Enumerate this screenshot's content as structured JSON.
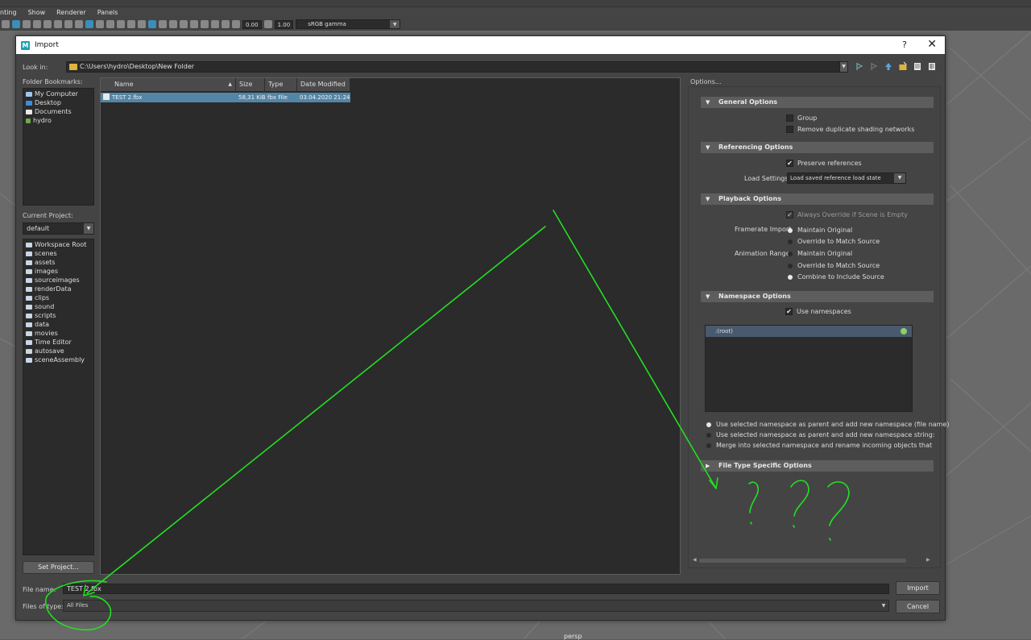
{
  "app": {
    "menu": [
      "nting",
      "Show",
      "Renderer",
      "Panels"
    ],
    "toolbar": {
      "exposure": "0.00",
      "gamma": "1.00",
      "color_space": "sRGB gamma"
    },
    "viewport_label": "persp"
  },
  "dialog": {
    "title": "Import",
    "help_glyph": "?",
    "close_glyph": "✕",
    "look_in_label": "Look in:",
    "look_in_path": "C:\\Users\\hydro\\Desktop\\New Folder",
    "folder_bookmarks_label": "Folder Bookmarks:",
    "bookmarks": [
      {
        "label": "My Computer",
        "icon": "computer-icon"
      },
      {
        "label": "Desktop",
        "icon": "desktop-icon"
      },
      {
        "label": "Documents",
        "icon": "documents-icon"
      },
      {
        "label": "hydro",
        "icon": "user-icon"
      }
    ],
    "current_project_label": "Current Project:",
    "current_project": "default",
    "project_folders": [
      "Workspace Root",
      "scenes",
      "assets",
      "images",
      "sourceimages",
      "renderData",
      "clips",
      "sound",
      "scripts",
      "data",
      "movies",
      "Time Editor",
      "autosave",
      "sceneAssembly"
    ],
    "set_project_button": "Set Project...",
    "table": {
      "columns": [
        "Name",
        "Size",
        "Type",
        "Date Modified"
      ],
      "rows": [
        {
          "name": "TEST 2.fbx",
          "size": "58,31 KiB",
          "type": "fbx File",
          "date": "03.04.2020 21:24"
        }
      ]
    },
    "file_name_label": "File name:",
    "file_name": "TEST 2.fbx",
    "files_of_type_label": "Files of type:",
    "files_of_type": "All Files",
    "import_button": "Import",
    "cancel_button": "Cancel"
  },
  "options": {
    "header": "Options...",
    "general": {
      "title": "General Options",
      "group": "Group",
      "remove_duplicate": "Remove duplicate shading networks"
    },
    "referencing": {
      "title": "Referencing Options",
      "preserve_references": "Preserve references",
      "load_settings_label": "Load Settings",
      "load_settings_value": "Load saved reference load state"
    },
    "playback": {
      "title": "Playback Options",
      "always_override": "Always Override if Scene is Empty",
      "framerate_label": "Framerate Import",
      "framerate_options": [
        "Maintain Original",
        "Override to Match Source"
      ],
      "anim_range_label": "Animation Range",
      "anim_range_options": [
        "Maintain Original",
        "Override to Match Source",
        "Combine to Include Source"
      ]
    },
    "namespace": {
      "title": "Namespace Options",
      "use_namespaces": "Use namespaces",
      "root": ":(root)",
      "choices": [
        "Use selected namespace as parent and add new namespace (file name)",
        "Use selected namespace as parent and add new namespace string:",
        "Merge into selected namespace and rename incoming objects that matc"
      ]
    },
    "file_type": {
      "title": "File Type Specific Options"
    }
  },
  "annotation": {
    "text": "???",
    "color": "#22e022"
  }
}
